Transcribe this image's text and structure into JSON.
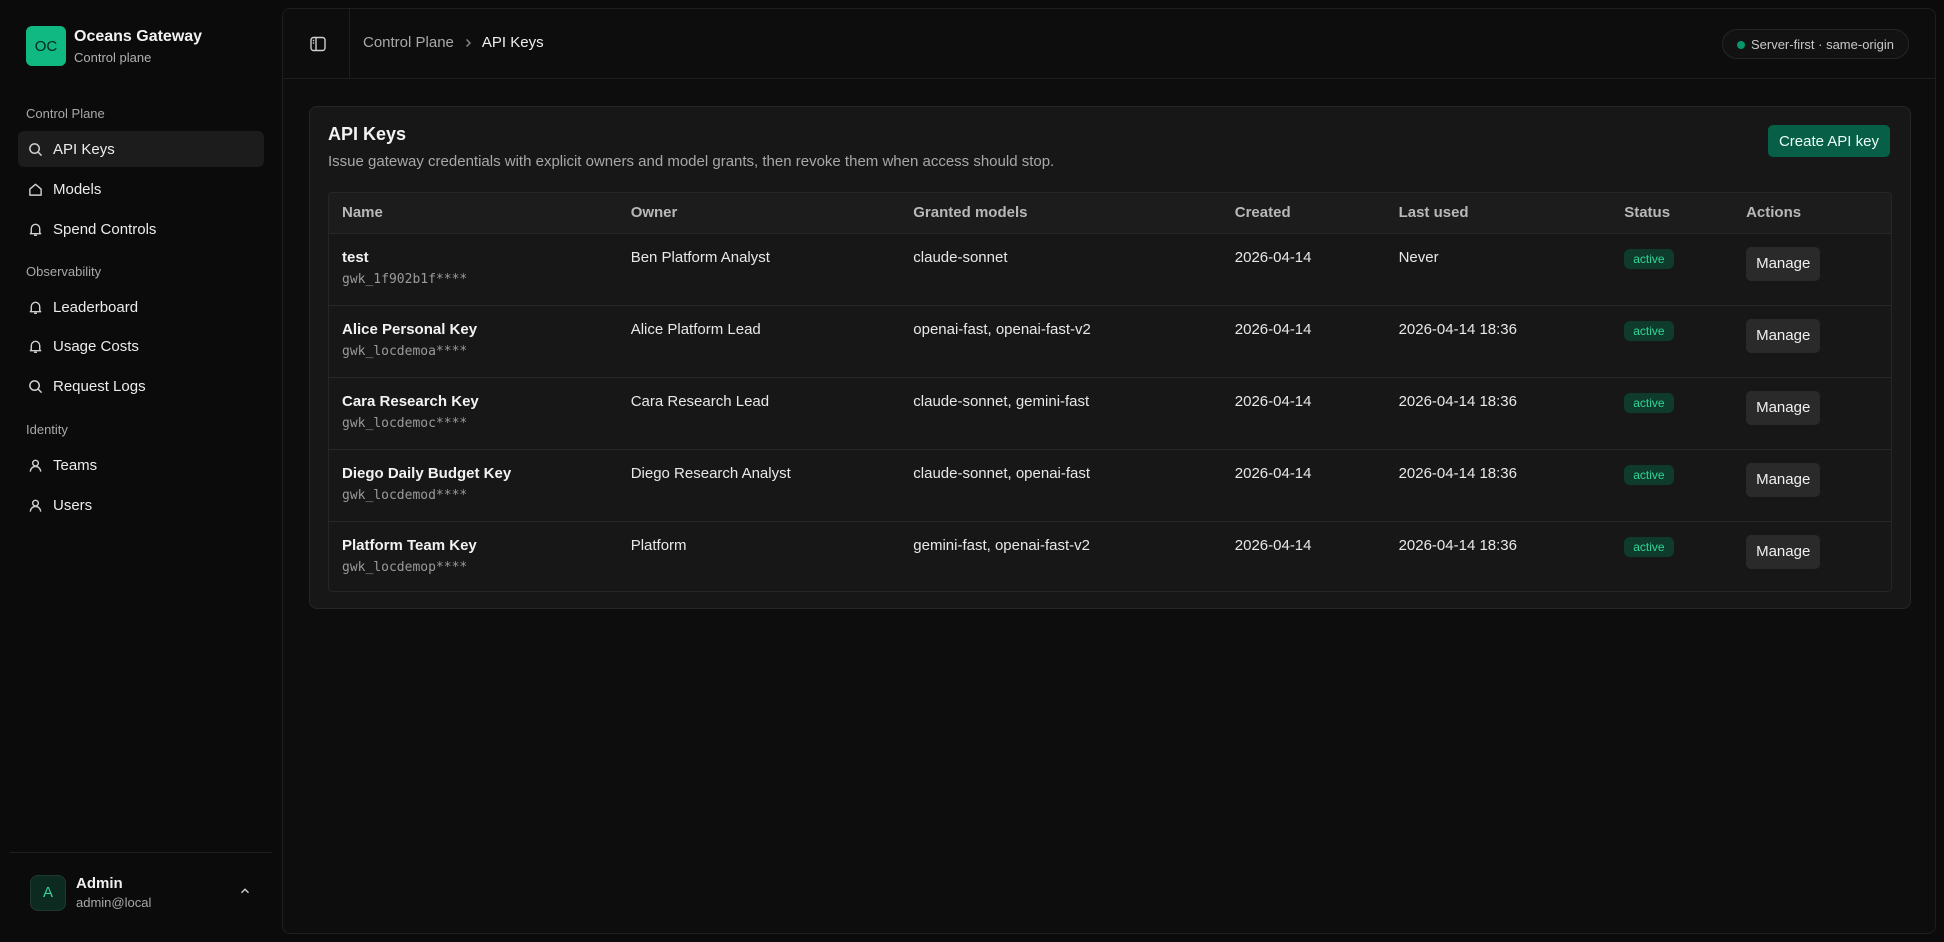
{
  "brand": {
    "logo_text": "OC",
    "name": "Oceans Gateway",
    "subtitle": "Control plane",
    "accent": "#10b981"
  },
  "sidebar": {
    "groups": [
      {
        "label": "Control Plane",
        "items": [
          {
            "label": "API Keys",
            "icon": "search-icon",
            "active": true
          },
          {
            "label": "Models",
            "icon": "house-icon",
            "active": false
          },
          {
            "label": "Spend Controls",
            "icon": "bell-icon",
            "active": false
          }
        ]
      },
      {
        "label": "Observability",
        "items": [
          {
            "label": "Leaderboard",
            "icon": "bell-icon",
            "active": false
          },
          {
            "label": "Usage Costs",
            "icon": "bell-icon",
            "active": false
          },
          {
            "label": "Request Logs",
            "icon": "search-icon",
            "active": false
          }
        ]
      },
      {
        "label": "Identity",
        "items": [
          {
            "label": "Teams",
            "icon": "user-icon",
            "active": false
          },
          {
            "label": "Users",
            "icon": "user-icon",
            "active": false
          }
        ]
      }
    ]
  },
  "user": {
    "initial": "A",
    "name": "Admin",
    "email": "admin@local"
  },
  "topbar": {
    "breadcrumb": {
      "parent": "Control Plane",
      "current": "API Keys"
    },
    "server_badge": "Server-first · same-origin"
  },
  "card": {
    "title": "API Keys",
    "description": "Issue gateway credentials with explicit owners and model grants, then revoke them when access should stop.",
    "create_label": "Create API key"
  },
  "table": {
    "columns": [
      "Name",
      "Owner",
      "Granted models",
      "Created",
      "Last used",
      "Status",
      "Actions"
    ],
    "rows": [
      {
        "name": "test",
        "prefix": "gwk_1f902b1f****",
        "owner": "Ben Platform Analyst",
        "models": "claude-sonnet",
        "created": "2026-04-14",
        "last_used": "Never",
        "status": "active",
        "action": "Manage"
      },
      {
        "name": "Alice Personal Key",
        "prefix": "gwk_locdemoa****",
        "owner": "Alice Platform Lead",
        "models": "openai-fast, openai-fast-v2",
        "created": "2026-04-14",
        "last_used": "2026-04-14 18:36",
        "status": "active",
        "action": "Manage"
      },
      {
        "name": "Cara Research Key",
        "prefix": "gwk_locdemoc****",
        "owner": "Cara Research Lead",
        "models": "claude-sonnet, gemini-fast",
        "created": "2026-04-14",
        "last_used": "2026-04-14 18:36",
        "status": "active",
        "action": "Manage"
      },
      {
        "name": "Diego Daily Budget Key",
        "prefix": "gwk_locdemod****",
        "owner": "Diego Research Analyst",
        "models": "claude-sonnet, openai-fast",
        "created": "2026-04-14",
        "last_used": "2026-04-14 18:36",
        "status": "active",
        "action": "Manage"
      },
      {
        "name": "Platform Team Key",
        "prefix": "gwk_locdemop****",
        "owner": "Platform",
        "models": "gemini-fast, openai-fast-v2",
        "created": "2026-04-14",
        "last_used": "2026-04-14 18:36",
        "status": "active",
        "action": "Manage"
      }
    ]
  },
  "colors": {
    "status_active": "#34d399",
    "create_button": "#065f46"
  }
}
